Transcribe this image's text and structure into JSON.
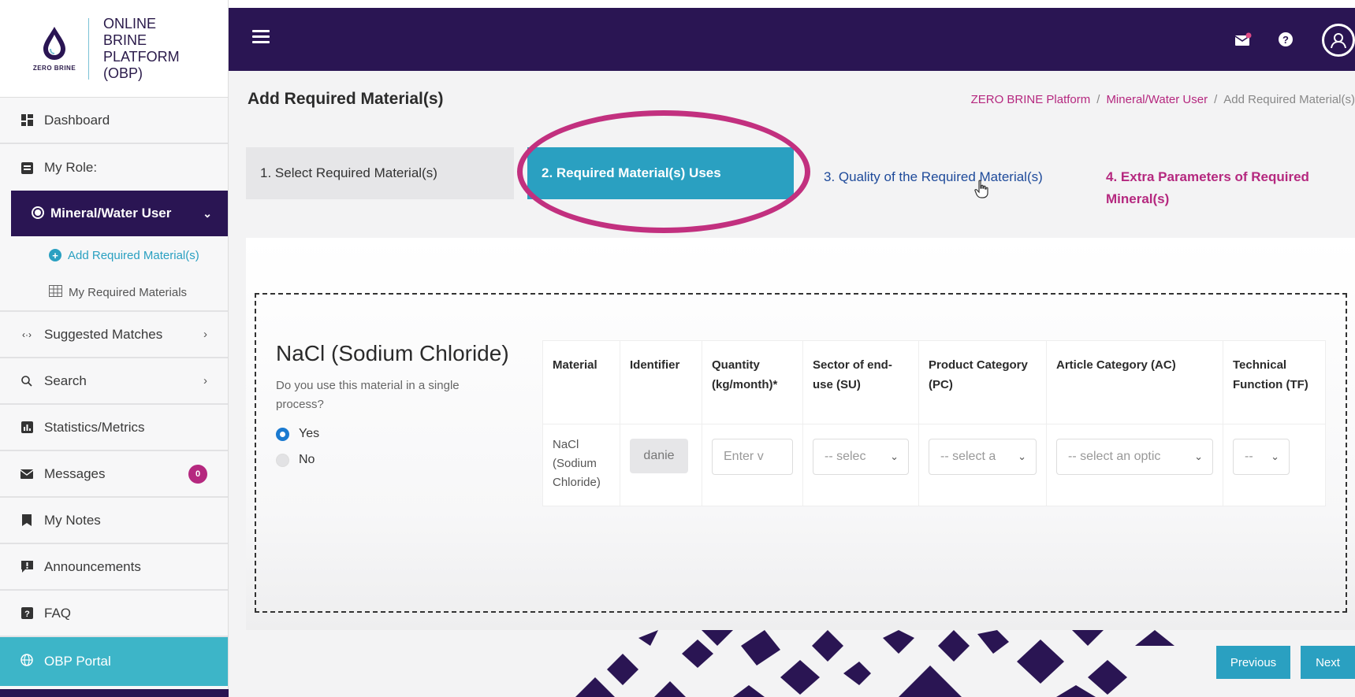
{
  "app": {
    "logo_brand": "ZERO BRINE",
    "logo_title": "ONLINE BRINE PLATFORM (OBP)"
  },
  "sidebar": {
    "dashboard": "Dashboard",
    "my_role": "My Role:",
    "role_active": "Mineral/Water User",
    "sub_items": [
      "Add Required Material(s)",
      "My Required Materials"
    ],
    "suggested_matches": "Suggested Matches",
    "search": "Search",
    "statistics": "Statistics/Metrics",
    "messages": "Messages",
    "messages_count": "0",
    "my_notes": "My Notes",
    "announcements": "Announcements",
    "faq": "FAQ",
    "portal": "OBP Portal"
  },
  "header": {
    "title": "Add Required Material(s)",
    "breadcrumb": [
      "ZERO BRINE Platform",
      "Mineral/Water User",
      "Add Required Material(s)"
    ]
  },
  "steps": [
    "1. Select Required Material(s)",
    "2. Required Material(s) Uses",
    "3. Quality of the Required Material(s)",
    "4. Extra Parameters of Required Mineral(s)"
  ],
  "material": {
    "title": "NaCl (Sodium Chloride)",
    "question": "Do you use this material in a single process?",
    "options": [
      "Yes",
      "No"
    ],
    "selected": "Yes"
  },
  "table": {
    "headers": [
      "Material",
      "Identifier",
      "Quantity (kg/month)*",
      "Sector of end-use (SU)",
      "Product Category (PC)",
      "Article Category (AC)",
      "Technical Function (TF)"
    ],
    "row": {
      "material": "NaCl (Sodium Chloride)",
      "identifier": "danie",
      "quantity_placeholder": "Enter v",
      "su": "-- selec",
      "pc": "-- select a",
      "ac": "-- select an optic",
      "tf": "--"
    }
  },
  "buttons": {
    "previous": "Previous",
    "next": "Next"
  },
  "colors": {
    "primary_dark": "#2a1553",
    "accent_teal": "#2aa0c1",
    "accent_magenta": "#b5287f"
  }
}
